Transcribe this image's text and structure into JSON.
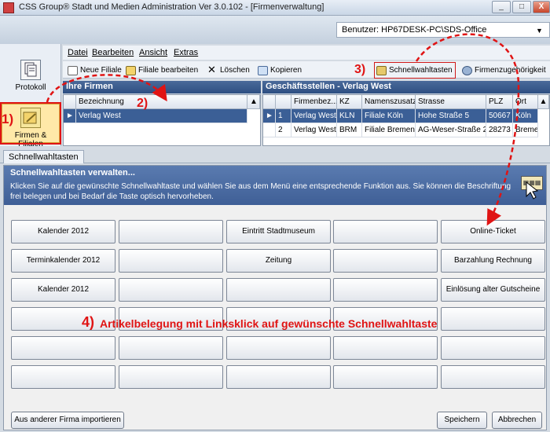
{
  "window": {
    "title": "CSS Group® Stadt und Medien Administration Ver 3.0.102 - [Firmenverwaltung]",
    "controls": [
      "_",
      "□",
      "X"
    ]
  },
  "user": {
    "text": "Benutzer: HP67DESK-PC\\SDS-Office"
  },
  "leftnav": [
    {
      "label": "Protokoll",
      "icon": "documents-icon"
    },
    {
      "label": "Firmen & Filialen",
      "icon": "folders-icon"
    }
  ],
  "menu": [
    "Datei",
    "Bearbeiten",
    "Ansicht",
    "Extras"
  ],
  "toolbar": {
    "items": [
      "Neue Filiale",
      "Filiale bearbeiten",
      "Löschen",
      "Kopieren",
      "Schnellwahltasten",
      "Firmenzugehörigkeit"
    ]
  },
  "companies": {
    "header": "Ihre Firmen",
    "column": "Bezeichnung",
    "rows": [
      "Verlag West"
    ]
  },
  "branches": {
    "header": "Geschäftsstellen  -  Verlag West",
    "columns": [
      "Firmenbez...",
      "KZ",
      "Namenszusatz",
      "Strasse",
      "PLZ",
      "Ort"
    ],
    "rows": [
      [
        "1",
        "Verlag West",
        "KLN",
        "Filiale Köln",
        "Hohe Straße 5",
        "50667",
        "Köln"
      ],
      [
        "2",
        "Verlag West",
        "BRM",
        "Filiale Bremen",
        "AG-Weser-Straße 2",
        "28273",
        "Bremen"
      ]
    ]
  },
  "tab": "Schnellwahltasten",
  "panel": {
    "title": "Schnellwahltasten verwalten...",
    "description": "Klicken Sie auf die gewünschte Schnellwahltaste und wählen Sie aus dem Menü eine entsprechende Funktion aus. Sie können die Beschriftung frei belegen und bei Bedarf die Taste optisch hervorheben.",
    "grid": [
      [
        "Kalender 2012",
        "",
        "Eintritt Stadtmuseum",
        "",
        "Online-Ticket"
      ],
      [
        "Terminkalender 2012",
        "",
        "Zeitung",
        "",
        "Barzahlung Rechnung"
      ],
      [
        "Kalender 2012",
        "",
        "",
        "",
        "Einlösung alter Gutscheine"
      ],
      [
        "",
        "",
        "",
        "",
        ""
      ],
      [
        "",
        "",
        "",
        "",
        ""
      ],
      [
        "",
        "",
        "",
        "",
        ""
      ]
    ],
    "import_button": "Aus anderer Firma importieren",
    "save_button": "Speichern",
    "cancel_button": "Abbrechen"
  },
  "annotations": {
    "a1": "1)",
    "a2": "2)",
    "a3": "3)",
    "a4_num": "4)",
    "a4_text": "Artikelbelegung mit Linksklick auf gewünschte Schnellwahltaste"
  },
  "colors": {
    "annotation": "#e01414",
    "header": "#3f5f96",
    "selection": "#3b5f96"
  }
}
